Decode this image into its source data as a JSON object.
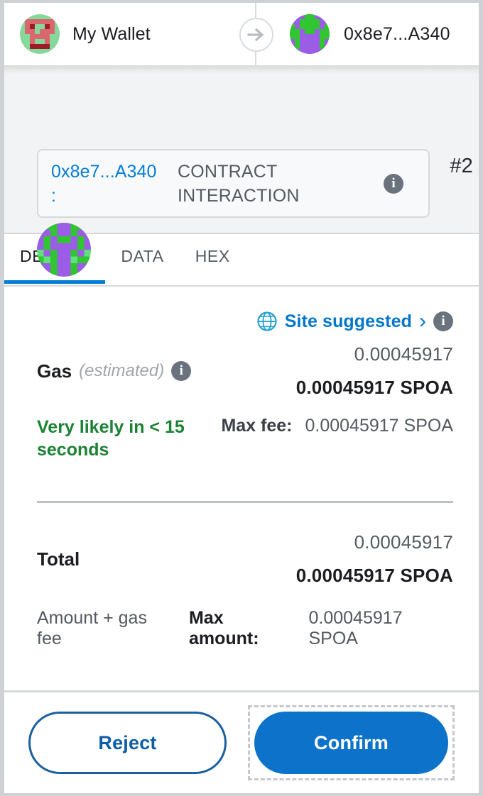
{
  "header": {
    "from_account": "My Wallet",
    "to_address": "0x8e7...A340",
    "arrow_icon": "arrow-right-icon"
  },
  "origin_panel": {
    "contract_address": "0x8e7...A340",
    "contract_address_separator": ":",
    "interaction_type": "CONTRACT INTERACTION",
    "info_icon": "info-icon",
    "nonce_label": "#2"
  },
  "tabs": [
    {
      "label": "DETAILS",
      "active": true
    },
    {
      "label": "DATA",
      "active": false
    },
    {
      "label": "HEX",
      "active": false
    }
  ],
  "gas_source": {
    "globe_icon": "globe-icon",
    "label": "Site suggested",
    "chevron": "›",
    "info_icon": "info-icon"
  },
  "gas": {
    "label": "Gas",
    "estimated_note": "(estimated)",
    "info_icon": "info-icon",
    "fiat_amount": "0.00045917",
    "native_amount": "0.00045917 SPOA",
    "speed_estimate": "Very likely in < 15 seconds",
    "max_fee_label": "Max fee:",
    "max_fee_value": "0.00045917 SPOA"
  },
  "total": {
    "label": "Total",
    "fiat_amount": "0.00045917",
    "native_amount": "0.00045917 SPOA",
    "sublabel": "Amount + gas fee",
    "max_amount_label": "Max amount:",
    "max_amount_value": "0.00045917 SPOA"
  },
  "footer": {
    "reject_label": "Reject",
    "confirm_label": "Confirm"
  },
  "colors": {
    "link_blue": "#037dd6",
    "accent_blue": "#0d73ca",
    "success_green": "#1c8234",
    "info_gray": "#6a737d",
    "globe_teal": "#29a3cf"
  }
}
